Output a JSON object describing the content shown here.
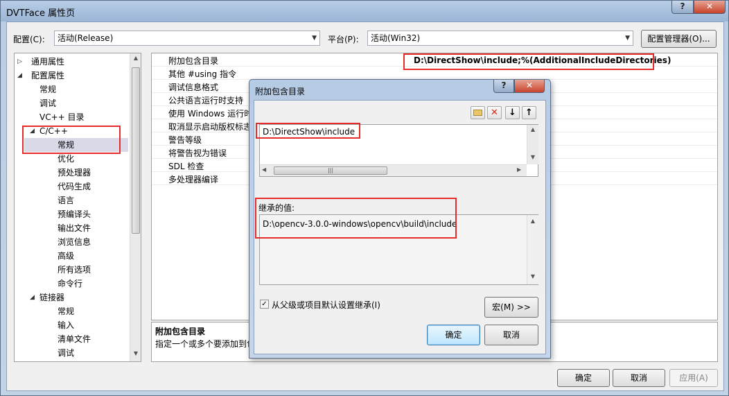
{
  "window": {
    "title": "DVTFace 属性页",
    "help_glyph": "?",
    "close_glyph": "✕"
  },
  "config_bar": {
    "config_label": "配置(C):",
    "config_value": "活动(Release)",
    "platform_label": "平台(P):",
    "platform_value": "活动(Win32)",
    "config_manager_button": "配置管理器(O)..."
  },
  "tree": {
    "items": [
      {
        "label": "通用属性",
        "expander": "▷",
        "level": 0
      },
      {
        "label": "配置属性",
        "expander": "◢",
        "level": 0
      },
      {
        "label": "常规",
        "level": 1
      },
      {
        "label": "调试",
        "level": 1
      },
      {
        "label": "VC++ 目录",
        "level": 1
      },
      {
        "label": "C/C++",
        "expander": "◢",
        "level": 1
      },
      {
        "label": "常规",
        "level": 2,
        "selected": true
      },
      {
        "label": "优化",
        "level": 2
      },
      {
        "label": "预处理器",
        "level": 2
      },
      {
        "label": "代码生成",
        "level": 2
      },
      {
        "label": "语言",
        "level": 2
      },
      {
        "label": "预编译头",
        "level": 2
      },
      {
        "label": "输出文件",
        "level": 2
      },
      {
        "label": "浏览信息",
        "level": 2
      },
      {
        "label": "高级",
        "level": 2
      },
      {
        "label": "所有选项",
        "level": 2
      },
      {
        "label": "命令行",
        "level": 2
      },
      {
        "label": "链接器",
        "expander": "◢",
        "level": 1
      },
      {
        "label": "常规",
        "level": 2
      },
      {
        "label": "输入",
        "level": 2
      },
      {
        "label": "清单文件",
        "level": 2
      },
      {
        "label": "调试",
        "level": 2
      }
    ]
  },
  "properties": {
    "rows": [
      {
        "name": "附加包含目录",
        "value": "D:\\DirectShow\\include;%(AdditionalIncludeDirectories)"
      },
      {
        "name": "其他 #using 指令",
        "value": ""
      },
      {
        "name": "调试信息格式",
        "value": ""
      },
      {
        "name": "公共语言运行时支持",
        "value": ""
      },
      {
        "name": "使用 Windows 运行时",
        "value": ""
      },
      {
        "name": "取消显示启动版权标志",
        "value": ""
      },
      {
        "name": "警告等级",
        "value": ""
      },
      {
        "name": "将警告视为错误",
        "value": ""
      },
      {
        "name": "SDL 检查",
        "value": ""
      },
      {
        "name": "多处理器编译",
        "value": ""
      }
    ],
    "description_title": "附加包含目录",
    "description_text": "指定一个或多个要添加到包"
  },
  "footer": {
    "ok": "确定",
    "cancel": "取消",
    "apply": "应用(A)"
  },
  "dialog": {
    "title": "附加包含目录",
    "help_glyph": "?",
    "close_glyph": "✕",
    "toolbar": {
      "new_folder_glyph": "📁",
      "delete_glyph": "✕",
      "down_glyph": "↓",
      "up_glyph": "↑"
    },
    "entries": [
      "D:\\DirectShow\\include"
    ],
    "inherited_label": "继承的值:",
    "inherited_values": [
      "D:\\opencv-3.0.0-windows\\opencv\\build\\include"
    ],
    "inherit_checkbox_label": "从父级或项目默认设置继承(I)",
    "inherit_checked": true,
    "macros_button": "宏(M) >>",
    "ok": "确定",
    "cancel": "取消"
  },
  "colors": {
    "highlight_box": "#e52b2b",
    "selected_tree_bg": "#d9d9e8"
  }
}
